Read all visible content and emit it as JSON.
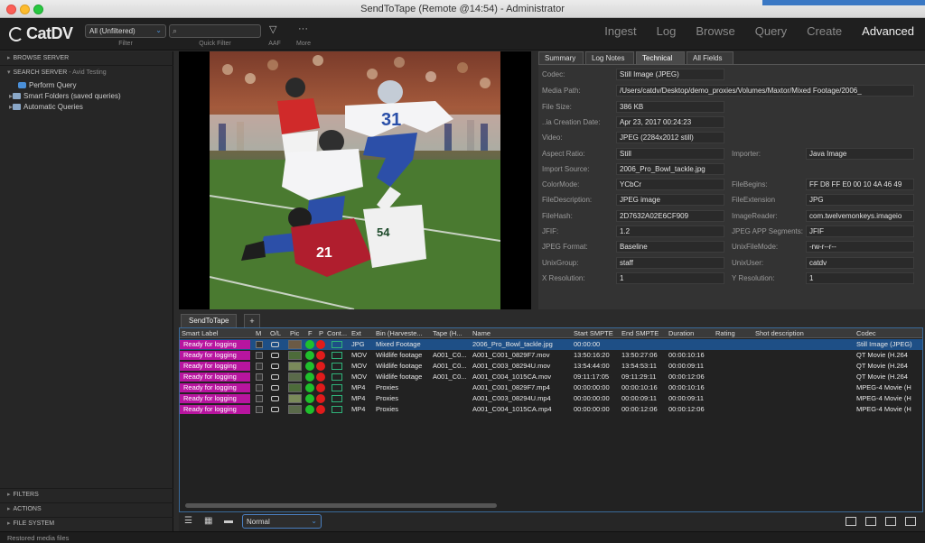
{
  "window": {
    "title": "SendToTape (Remote @14:54) - Administrator"
  },
  "toolbar": {
    "logo_text": "CatDV",
    "filter_value": "All (Unfiltered)",
    "filter_label": "Filter",
    "quick_filter_label": "Quick Filter",
    "aaf_label": "AAF",
    "more_label": "More",
    "nav": [
      "Ingest",
      "Log",
      "Browse",
      "Query",
      "Create",
      "Advanced"
    ],
    "active_nav": "Advanced"
  },
  "sidebar": {
    "browse_server": "BROWSE SERVER",
    "search_server": "SEARCH SERVER",
    "search_server_sub": "- Avid Testing",
    "items": [
      "Perform Query",
      "Smart Folders (saved queries)",
      "Automatic Queries"
    ],
    "filters": "FILTERS",
    "actions": "ACTIONS",
    "file_system": "FILE SYSTEM"
  },
  "details": {
    "tabs": [
      "Summary",
      "Log Notes",
      "Technical",
      "All Fields"
    ],
    "active_tab": "Technical",
    "codec_label": "Codec:",
    "codec": "Still Image (JPEG)",
    "media_path_label": "Media Path:",
    "media_path": "/Users/catdv/Desktop/demo_proxies/Volumes/Maxtor/Mixed Footage/2006_",
    "file_size_label": "File Size:",
    "file_size": "386 KB",
    "creation_label": "..ia Creation Date:",
    "creation": "Apr 23, 2017 00:24:23",
    "video_label": "Video:",
    "video": "JPEG (2284x2012 still)",
    "aspect_label": "Aspect Ratio:",
    "aspect": "Still",
    "importer_label": "Importer:",
    "importer": "Java Image",
    "import_source_label": "Import Source:",
    "import_source": "2006_Pro_Bowl_tackle.jpg",
    "colormode_label": "ColorMode:",
    "colormode": "YCbCr",
    "filebegins_label": "FileBegins:",
    "filebegins": "FF D8 FF E0 00 10 4A 46 49",
    "filedesc_label": "FileDescription:",
    "filedesc": "JPEG image",
    "fileext_label": "FileExtension",
    "fileext": "JPG",
    "filehash_label": "FileHash:",
    "filehash": "2D7632A02E6CF909",
    "imagereader_label": "ImageReader:",
    "imagereader": "com.twelvemonkeys.imageio",
    "jfif_label": "JFIF:",
    "jfif": "1.2",
    "jpegapp_label": "JPEG APP Segments:",
    "jpegapp": "JFIF",
    "jpegformat_label": "JPEG Format:",
    "jpegformat": "Baseline",
    "unixfilemode_label": "UnixFileMode:",
    "unixfilemode": "-rw-r--r--",
    "unixgroup_label": "UnixGroup:",
    "unixgroup": "staff",
    "unixuser_label": "UnixUser:",
    "unixuser": "catdv",
    "xres_label": "X Resolution:",
    "xres": "1",
    "yres_label": "Y Resolution:",
    "yres": "1"
  },
  "clip_list": {
    "tab": "SendToTape",
    "add_tab": "+",
    "columns": [
      "Smart Label",
      "M",
      "O/L",
      "Pic",
      "F",
      "P",
      "Cont...",
      "Ext",
      "Bin (Harveste...",
      "Tape (H...",
      "Name",
      "Start SMPTE",
      "End SMPTE",
      "Duration",
      "Rating",
      "Shot description",
      "Codec"
    ],
    "rows": [
      {
        "label": "Ready for logging",
        "ext": "JPG",
        "bin": "Mixed Footage",
        "tape": "",
        "name": "2006_Pro_Bowl_tackle.jpg",
        "start": "00:00:00",
        "end": "",
        "duration": "",
        "codec": "Still Image (JPEG)"
      },
      {
        "label": "Ready for logging",
        "ext": "MOV",
        "bin": "Wildlife footage",
        "tape": "A001_C0...",
        "name": "A001_C001_0829F7.mov",
        "start": "13:50:16:20",
        "end": "13:50:27:06",
        "duration": "00:00:10:16",
        "codec": "QT Movie (H.264"
      },
      {
        "label": "Ready for logging",
        "ext": "MOV",
        "bin": "Wildlife footage",
        "tape": "A001_C0...",
        "name": "A001_C003_08294U.mov",
        "start": "13:54:44:00",
        "end": "13:54:53:11",
        "duration": "00:00:09:11",
        "codec": "QT Movie (H.264"
      },
      {
        "label": "Ready for logging",
        "ext": "MOV",
        "bin": "Wildlife footage",
        "tape": "A001_C0...",
        "name": "A001_C004_1015CA.mov",
        "start": "09:11:17:05",
        "end": "09:11:29:11",
        "duration": "00:00:12:06",
        "codec": "QT Movie (H.264"
      },
      {
        "label": "Ready for logging",
        "ext": "MP4",
        "bin": "Proxies",
        "tape": "",
        "name": "A001_C001_0829F7.mp4",
        "start": "00:00:00:00",
        "end": "00:00:10:16",
        "duration": "00:00:10:16",
        "codec": "MPEG-4 Movie (H"
      },
      {
        "label": "Ready for logging",
        "ext": "MP4",
        "bin": "Proxies",
        "tape": "",
        "name": "A001_C003_08294U.mp4",
        "start": "00:00:00:00",
        "end": "00:00:09:11",
        "duration": "00:00:09:11",
        "codec": "MPEG-4 Movie (H"
      },
      {
        "label": "Ready for logging",
        "ext": "MP4",
        "bin": "Proxies",
        "tape": "",
        "name": "A001_C004_1015CA.mp4",
        "start": "00:00:00:00",
        "end": "00:00:12:06",
        "duration": "00:00:12:06",
        "codec": "MPEG-4 Movie (H"
      }
    ]
  },
  "bottom": {
    "view_mode": "Normal"
  },
  "status": "Restored media files",
  "colors": {
    "smart_label": "#b8159f",
    "selected_row": "#1e4f86",
    "flag_green": "#1fbf2c",
    "flag_red": "#e11b1b"
  }
}
